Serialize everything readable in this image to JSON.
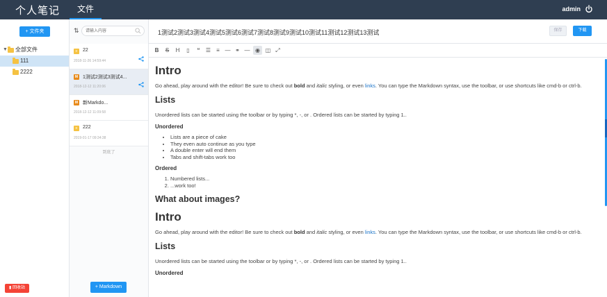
{
  "topbar": {
    "app_title": "个人笔记",
    "tab_label": "文件",
    "username": "admin",
    "power_icon": "power-icon"
  },
  "folders": {
    "new_folder_label": "+ 文件夹",
    "tree": [
      {
        "label": "全部文件",
        "level": 0,
        "expanded": true,
        "active": false
      },
      {
        "label": "111",
        "level": 1,
        "active": true
      },
      {
        "label": "2222",
        "level": 1,
        "active": false
      }
    ],
    "trash_label": "回收站"
  },
  "notes": {
    "search_placeholder": "请输入内容",
    "items": [
      {
        "title": "22",
        "date": "2018-11-26 14:59:44",
        "type": "note",
        "badge_color": "#f5c242",
        "shared": true,
        "active": false
      },
      {
        "title": "1测试2测试3测试4...",
        "date": "2018-12-12 11:20:06",
        "type": "markdown",
        "badge_color": "#e88a1a",
        "shared": true,
        "active": true
      },
      {
        "title": "新Markdo...",
        "date": "2018-12-12 11:09:58",
        "type": "markdown",
        "badge_color": "#e88a1a",
        "shared": false,
        "active": false
      },
      {
        "title": "222",
        "date": "2019-01-17 09:34:38",
        "type": "note",
        "badge_color": "#f5c242",
        "shared": false,
        "active": false
      }
    ],
    "list_end": "到底了",
    "new_md_label": "+ Markdown"
  },
  "editor": {
    "title": "1测试2测试3测试4测试5测试6测试7测试8测试9测试10测试11测试12测试13测试",
    "save_label": "保存",
    "download_label": "下载",
    "toolbar": [
      "B",
      "S",
      "H",
      "”",
      "“",
      "☰",
      "≡",
      "—",
      "⚭",
      "―",
      "◉",
      "◫",
      "⤢"
    ],
    "intro_h": "Intro",
    "intro_p1": "Go ahead, play around with the editor! Be sure to check out ",
    "bold": "bold",
    "and": " and ",
    "italic": "italic",
    "styling": " styling, or even ",
    "links": "links",
    "intro_p2": ". You can type the Markdown syntax, use the toolbar, or use shortcuts like cmd-b or ctrl-b.",
    "lists_h": "Lists",
    "lists_p": "Unordered lists can be started using the toolbar or by typing *, -, or . Ordered lists can be started by typing 1..",
    "unordered_h": "Unordered",
    "unordered_items": [
      "Lists are a piece of cake",
      "They even auto continue as you type",
      "A double enter will end them",
      "Tabs and shift-tabs work too"
    ],
    "ordered_h": "Ordered",
    "ordered_items": [
      "Numbered lists...",
      "...work too!"
    ],
    "images_h": "What about images?"
  }
}
